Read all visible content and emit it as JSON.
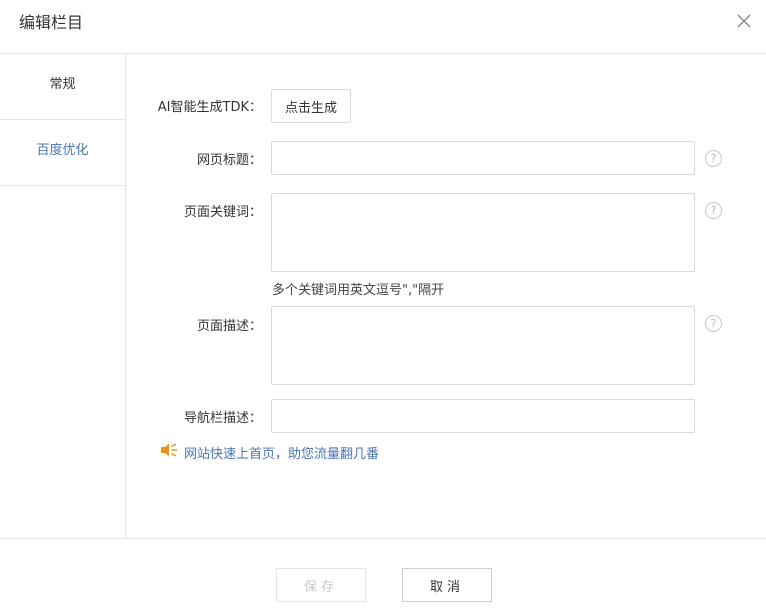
{
  "dialog": {
    "title": "编辑栏目"
  },
  "tabs": [
    {
      "label": "常规"
    },
    {
      "label": "百度优化"
    }
  ],
  "form": {
    "ai_label": "AI智能生成TDK：",
    "ai_button": "点击生成",
    "page_title_label": "网页标题：",
    "page_title_value": "",
    "keywords_label": "页面关键词：",
    "keywords_value": "",
    "keywords_hint": "多个关键词用英文逗号\",\"隔开",
    "description_label": "页面描述：",
    "description_value": "",
    "nav_desc_label": "导航栏描述：",
    "nav_desc_value": "",
    "help_glyph": "?"
  },
  "promo": {
    "text": "网站快速上首页，助您流量翻几番",
    "icon": "speaker-icon",
    "icon_color": "#e8941a"
  },
  "footer": {
    "save": "保存",
    "cancel": "取消"
  },
  "colors": {
    "accent": "#4a74b5",
    "border": "#e5e5e5"
  }
}
